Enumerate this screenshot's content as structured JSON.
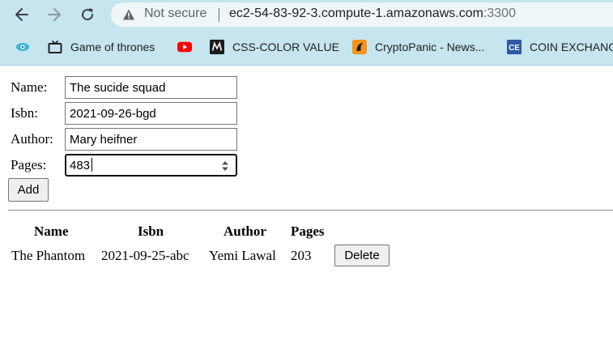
{
  "browser": {
    "security_label": "Not secure",
    "url_host": "ec2-54-83-92-3.compute-1.amazonaws.com",
    "url_port": ":3300",
    "bookmarks": [
      {
        "label": "",
        "icon": "eye-icon"
      },
      {
        "label": "Game of thrones",
        "icon": "tv-icon"
      },
      {
        "label": "",
        "icon": "youtube-icon"
      },
      {
        "label": "CSS-COLOR VALUE",
        "icon": "m-logo-icon"
      },
      {
        "label": "CryptoPanic - News...",
        "icon": "cryptopanic-icon"
      },
      {
        "label": "COIN EXCHANGE",
        "icon": "ce-icon"
      }
    ]
  },
  "form": {
    "name_label": "Name:",
    "name_value": "The sucide squad",
    "isbn_label": "Isbn:",
    "isbn_value": "2021-09-26-bgd",
    "author_label": "Author:",
    "author_value": "Mary heifner",
    "pages_label": "Pages:",
    "pages_value": "483",
    "add_label": "Add"
  },
  "table": {
    "headers": [
      "Name",
      "Isbn",
      "Author",
      "Pages"
    ],
    "rows": [
      {
        "name": "The Phantom",
        "isbn": "2021-09-25-abc",
        "author": "Yemi Lawal",
        "pages": "203",
        "delete_label": "Delete"
      }
    ]
  },
  "colors": {
    "chrome_bg": "#c6e5ee",
    "omnibox_bg": "#eff6f8",
    "youtube_red": "#ff0000",
    "cryptopanic_orange": "#f7931a",
    "ce_blue": "#2b5aa8"
  }
}
